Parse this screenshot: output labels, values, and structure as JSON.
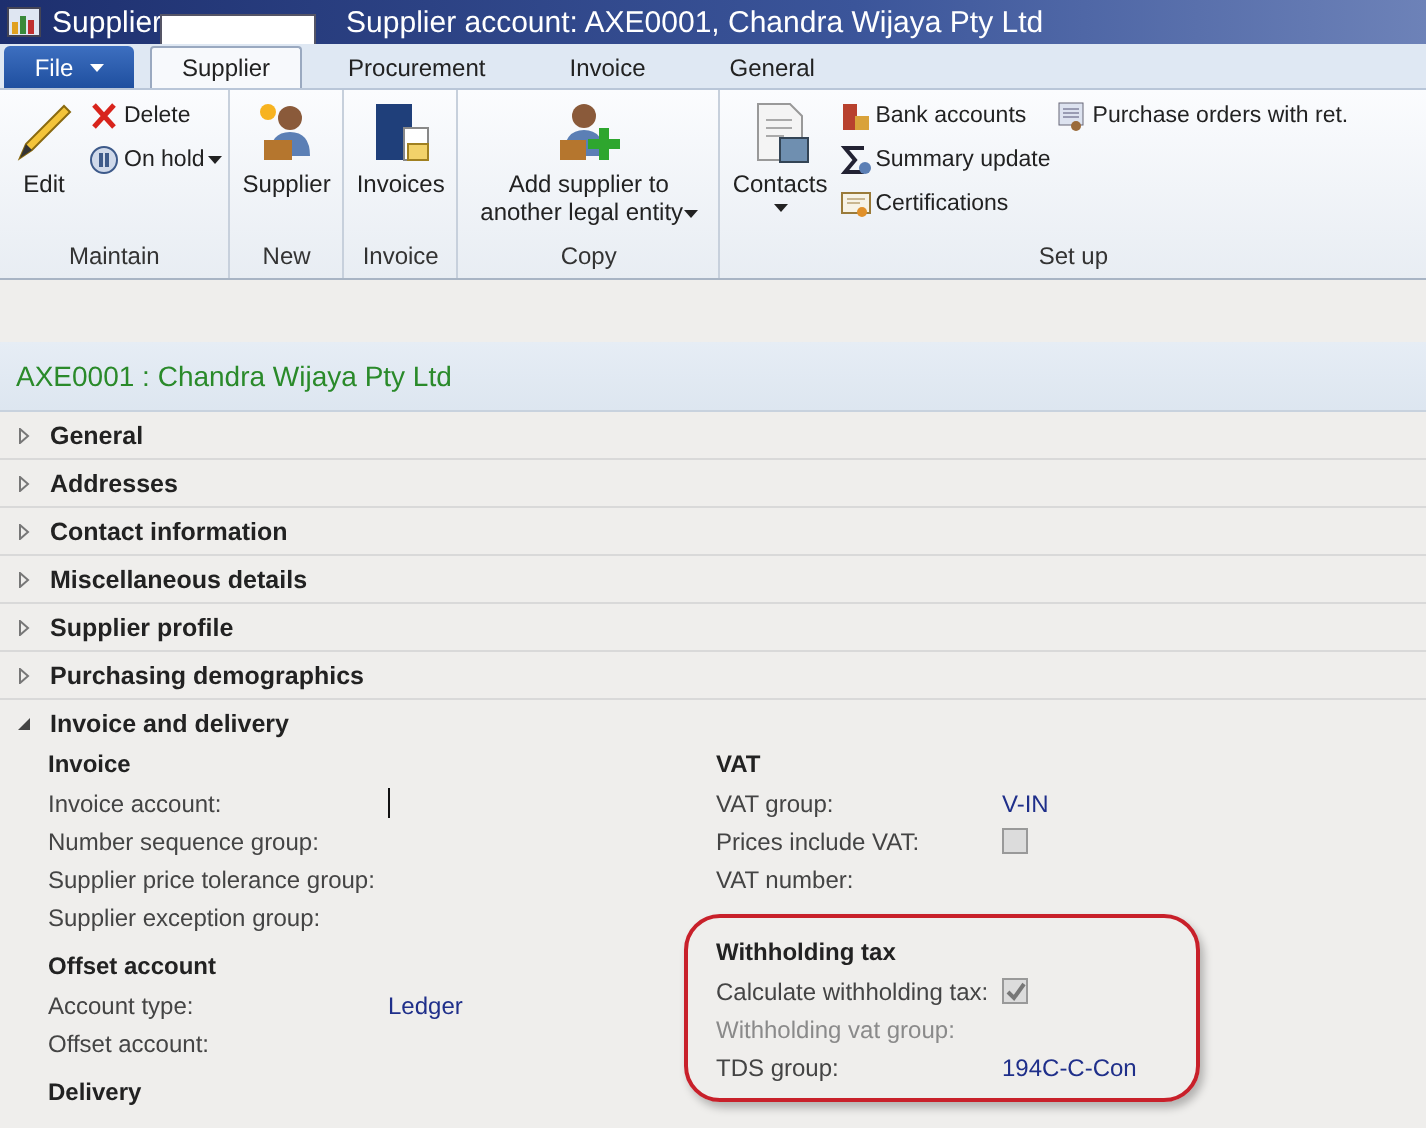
{
  "window": {
    "title_start": "Supplier",
    "title_rest": "Supplier account: AXE0001, Chandra Wijaya Pty Ltd"
  },
  "tabs": [
    {
      "label": "File",
      "kind": "file",
      "selected": false
    },
    {
      "label": "Supplier",
      "kind": "tab",
      "selected": true
    },
    {
      "label": "Procurement",
      "kind": "tab",
      "selected": false
    },
    {
      "label": "Invoice",
      "kind": "tab",
      "selected": false
    },
    {
      "label": "General",
      "kind": "tab",
      "selected": false
    }
  ],
  "ribbon": [
    {
      "label": "Maintain",
      "columns": [
        [
          {
            "label": "Edit",
            "kind": "large",
            "dropdown": false
          }
        ],
        [
          {
            "label": "Delete",
            "kind": "small",
            "dropdown": false
          },
          {
            "label": "On hold",
            "kind": "small",
            "dropdown": true
          }
        ]
      ]
    },
    {
      "label": "New",
      "columns": [
        [
          {
            "label": "Supplier",
            "kind": "large",
            "dropdown": false
          }
        ]
      ]
    },
    {
      "label": "Invoice",
      "columns": [
        [
          {
            "label": "Invoices",
            "kind": "large",
            "dropdown": false
          }
        ]
      ]
    },
    {
      "label": "Copy",
      "columns": [
        [
          {
            "label": "Add supplier to another legal entity",
            "kind": "large",
            "dropdown": true
          }
        ]
      ]
    },
    {
      "label": "Set up",
      "columns": [
        [
          {
            "label": "Contacts",
            "kind": "large",
            "dropdown": true
          }
        ],
        [
          {
            "label": "Bank accounts",
            "kind": "small",
            "dropdown": false
          },
          {
            "label": "Summary update",
            "kind": "small",
            "dropdown": false
          },
          {
            "label": "Certifications",
            "kind": "small",
            "dropdown": false
          }
        ],
        [
          {
            "label": "Purchase orders with ret.",
            "kind": "small",
            "dropdown": false
          }
        ]
      ]
    }
  ],
  "record_title": "AXE0001 : Chandra Wijaya Pty Ltd",
  "sections": [
    {
      "title": "General",
      "expanded": false
    },
    {
      "title": "Addresses",
      "expanded": false
    },
    {
      "title": "Contact information",
      "expanded": false
    },
    {
      "title": "Miscellaneous details",
      "expanded": false
    },
    {
      "title": "Supplier profile",
      "expanded": false
    },
    {
      "title": "Purchasing demographics",
      "expanded": false
    },
    {
      "title": "Invoice and delivery",
      "expanded": true,
      "columns": [
        [
          {
            "title": "Invoice",
            "highlighted": false,
            "fields": [
              {
                "label": "Invoice account:",
                "kind": "text",
                "focused": true,
                "disabled": false
              },
              {
                "label": "Number sequence group:",
                "kind": "text",
                "focused": false,
                "disabled": false
              },
              {
                "label": "Supplier price tolerance group:",
                "kind": "text",
                "focused": false,
                "disabled": false
              },
              {
                "label": "Supplier exception group:",
                "kind": "text",
                "focused": false,
                "disabled": false
              }
            ]
          },
          {
            "title": "Offset account",
            "highlighted": false,
            "fields": [
              {
                "label": "Account type:",
                "kind": "text",
                "value": "Ledger",
                "focused": false,
                "disabled": false
              },
              {
                "label": "Offset account:",
                "kind": "text",
                "focused": false,
                "disabled": false
              }
            ]
          },
          {
            "title": "Delivery",
            "highlighted": false
          }
        ],
        [
          {
            "title": "VAT",
            "highlighted": false,
            "fields": [
              {
                "label": "VAT group:",
                "kind": "text",
                "value": "V-IN",
                "focused": false,
                "disabled": false
              },
              {
                "label": "Prices include VAT:",
                "kind": "checkbox",
                "checked": false,
                "disabled": false
              },
              {
                "label": "VAT number:",
                "kind": "text",
                "focused": false,
                "disabled": false
              }
            ]
          },
          {
            "title": "Withholding tax",
            "highlighted": true,
            "fields": [
              {
                "label": "Calculate withholding tax:",
                "kind": "checkbox",
                "checked": true,
                "disabled": false
              },
              {
                "label": "Withholding vat group:",
                "kind": "text",
                "focused": false,
                "disabled": true
              },
              {
                "label": "TDS group:",
                "kind": "text",
                "value": "194C-C-Con",
                "focused": false,
                "disabled": false
              }
            ]
          }
        ]
      ]
    }
  ]
}
